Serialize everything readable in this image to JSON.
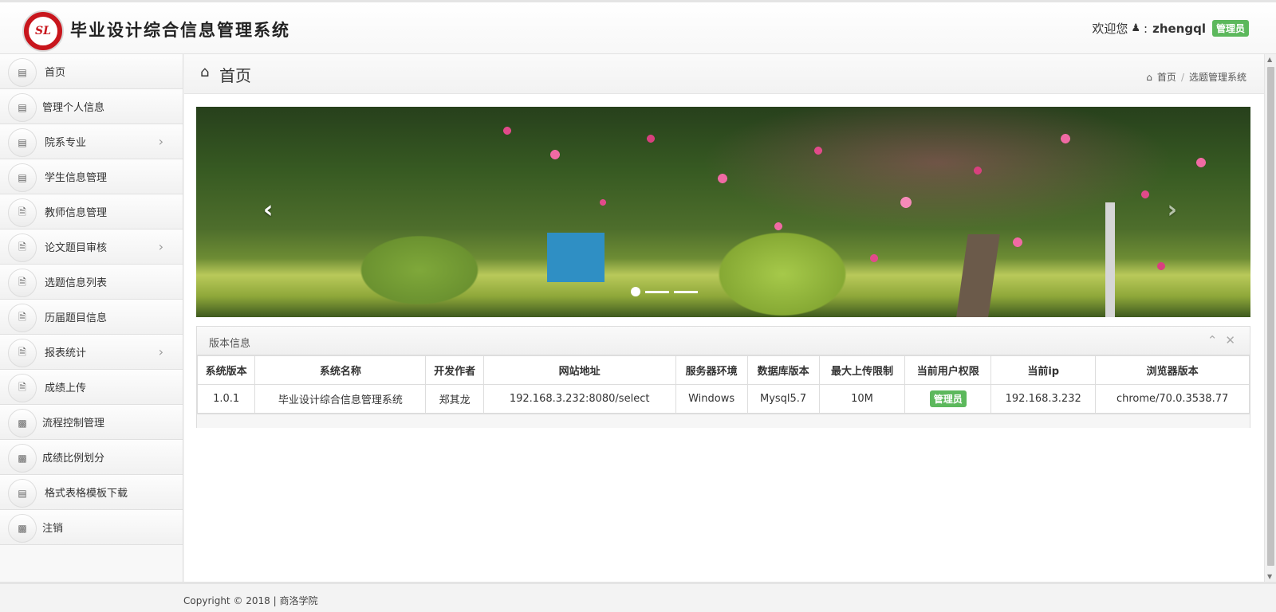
{
  "header": {
    "logo_text": "SL",
    "app_title": "毕业设计综合信息管理系统",
    "welcome_text": "欢迎您",
    "user_icon": "user-icon",
    "username_prefix": ":",
    "username": "zhengql",
    "role_badge": "管理员",
    "badge_color": "#5cb85c"
  },
  "sidebar": {
    "items": [
      {
        "label": "首页",
        "icon": "list-icon",
        "has_children": false
      },
      {
        "label": "管理个人信息",
        "icon": "list-icon",
        "has_children": false
      },
      {
        "label": "院系专业",
        "icon": "list-icon",
        "has_children": true
      },
      {
        "label": "学生信息管理",
        "icon": "list-icon",
        "has_children": false
      },
      {
        "label": "教师信息管理",
        "icon": "file-icon",
        "has_children": false
      },
      {
        "label": "论文题目审核",
        "icon": "file-icon",
        "has_children": true
      },
      {
        "label": "选题信息列表",
        "icon": "file-icon",
        "has_children": false
      },
      {
        "label": "历届题目信息",
        "icon": "file-icon",
        "has_children": false
      },
      {
        "label": "报表统计",
        "icon": "file-icon",
        "has_children": true
      },
      {
        "label": "成绩上传",
        "icon": "file-icon",
        "has_children": false
      },
      {
        "label": "流程控制管理",
        "icon": "bar-chart-icon",
        "has_children": false
      },
      {
        "label": "成绩比例划分",
        "icon": "bar-chart-icon",
        "has_children": false
      },
      {
        "label": "格式表格模板下载",
        "icon": "list-icon",
        "has_children": false
      },
      {
        "label": "注销",
        "icon": "bar-chart-icon",
        "has_children": false
      }
    ]
  },
  "main": {
    "page_title": "首页",
    "breadcrumb": {
      "home": "首页",
      "separator": "/",
      "current": "选题管理系统"
    },
    "carousel": {
      "prev_label": "‹",
      "next_label": "›",
      "slide_count": 3,
      "active_index": 0
    },
    "version_panel": {
      "title": "版本信息",
      "columns": [
        "系统版本",
        "系统名称",
        "开发作者",
        "网站地址",
        "服务器环境",
        "数据库版本",
        "最大上传限制",
        "当前用户权限",
        "当前ip",
        "浏览器版本"
      ],
      "row": {
        "version": "1.0.1",
        "name": "毕业设计综合信息管理系统",
        "author": "郑其龙",
        "url": "192.168.3.232:8080/select",
        "server": "Windows",
        "database": "Mysql5.7",
        "upload_limit": "10M",
        "permission": "管理员",
        "ip": "192.168.3.232",
        "browser": "chrome/70.0.3538.77"
      }
    }
  },
  "footer": {
    "copyright": "Copyright © 2018 | 商洛学院"
  }
}
